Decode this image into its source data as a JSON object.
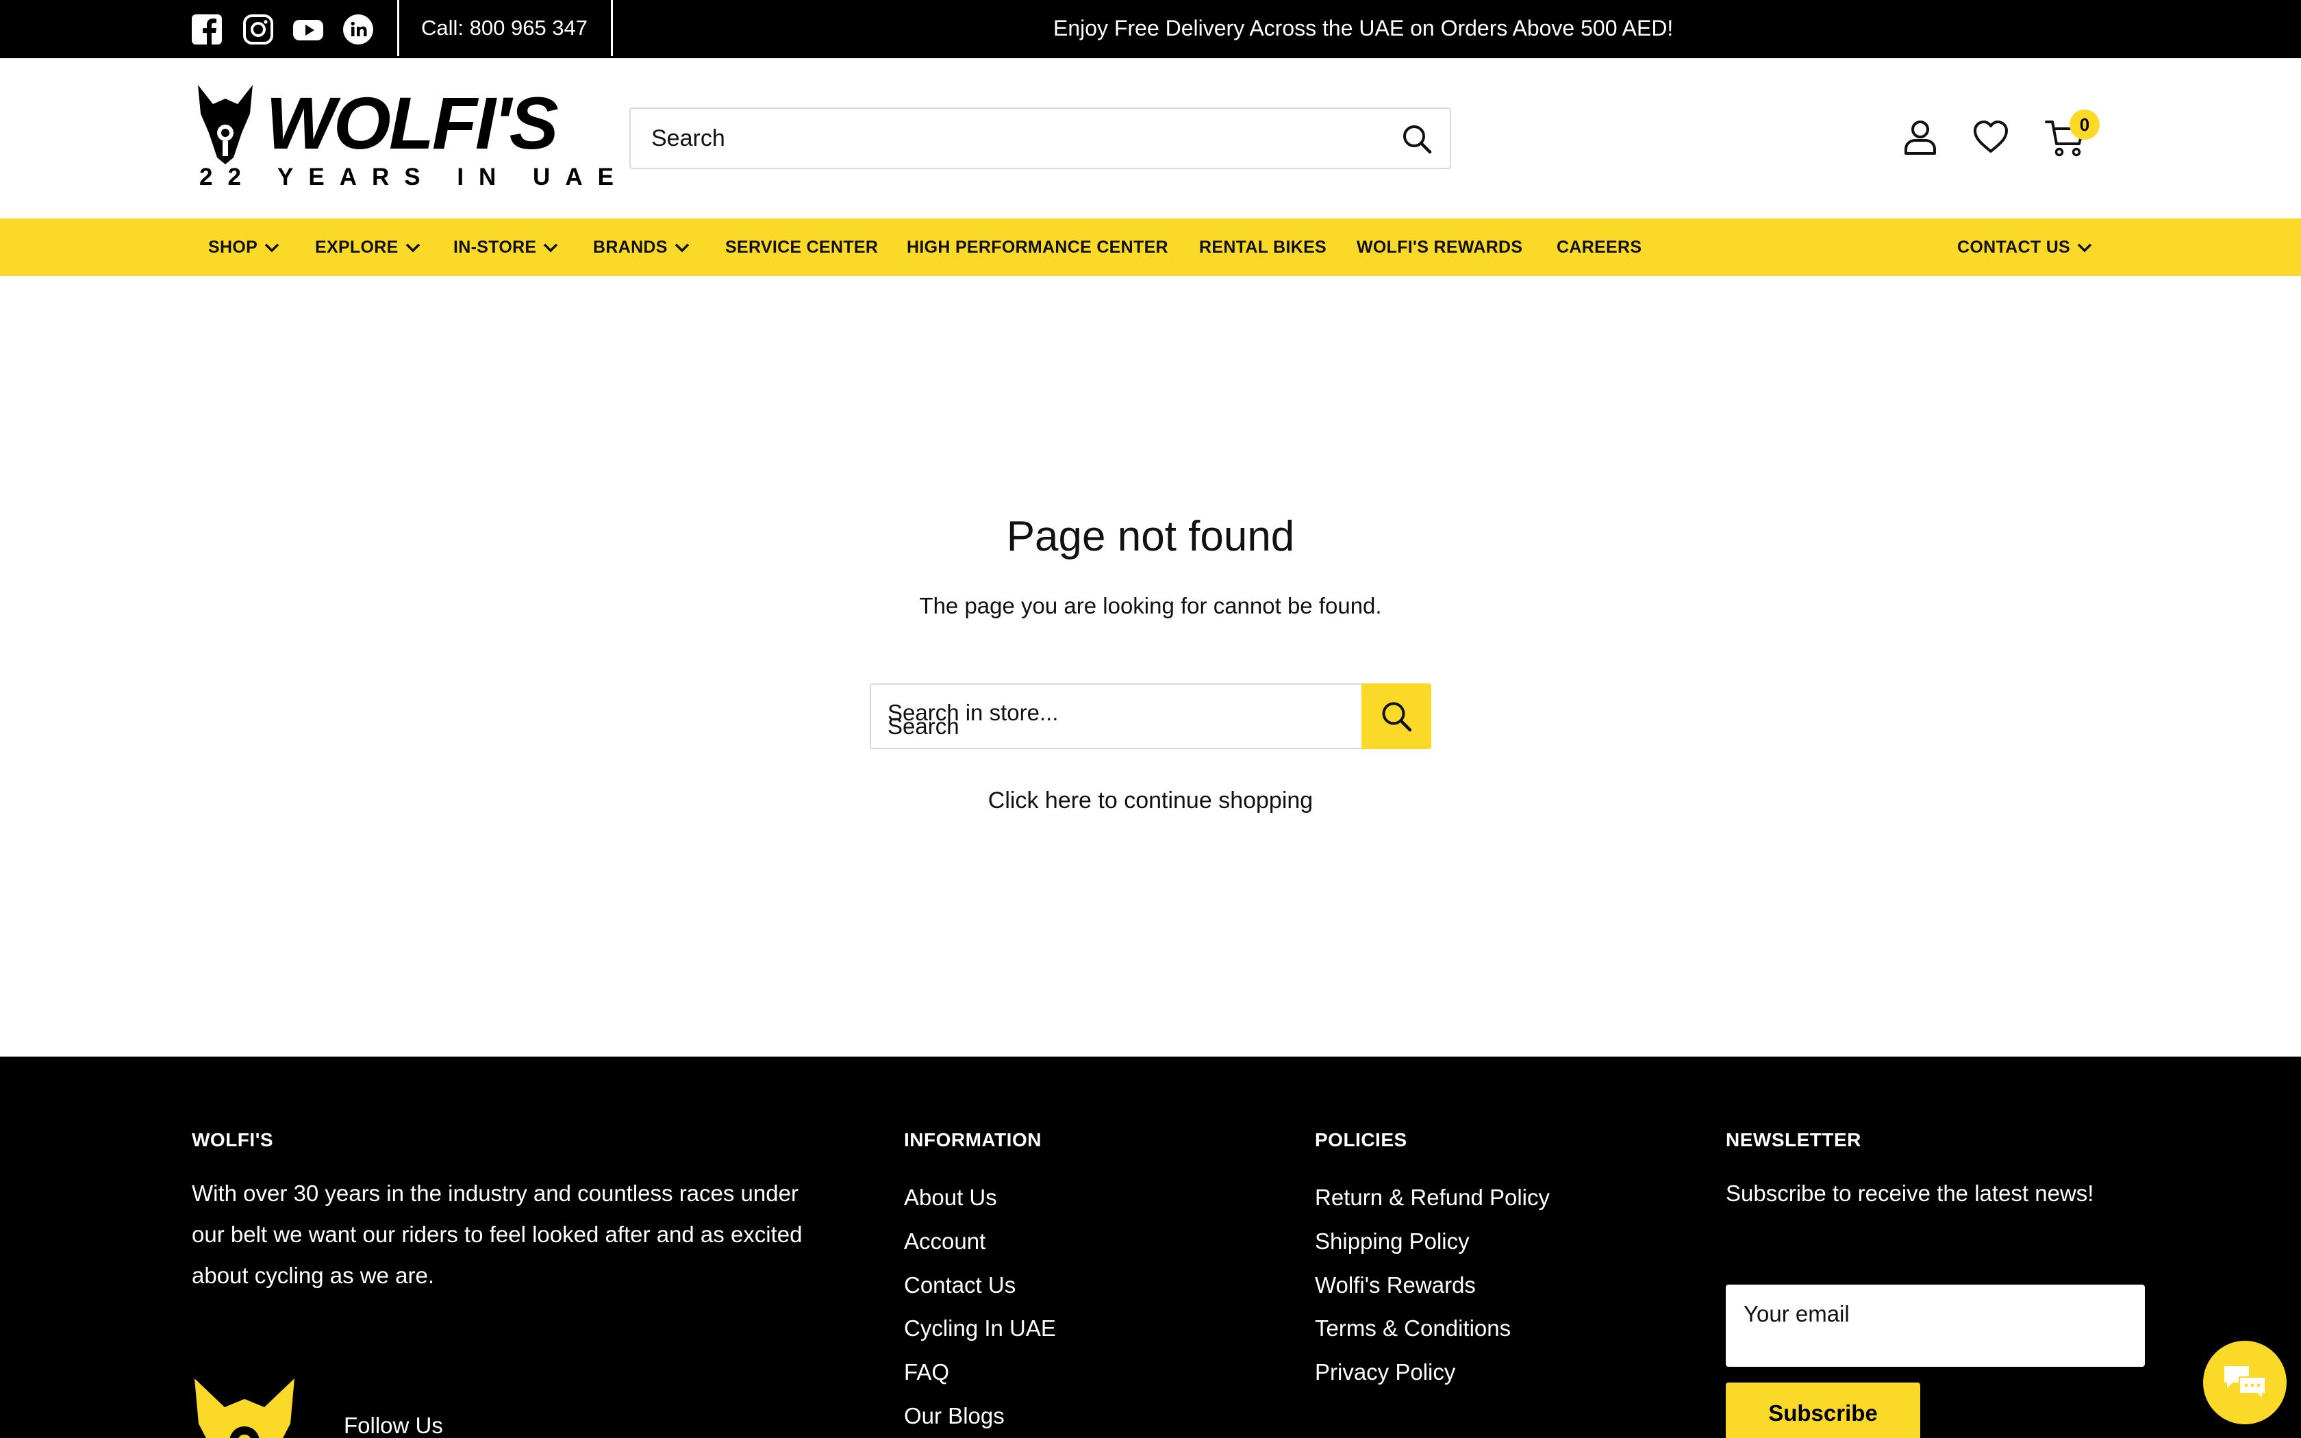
{
  "topbar": {
    "social": [
      {
        "name": "facebook-icon"
      },
      {
        "name": "instagram-icon"
      },
      {
        "name": "youtube-icon"
      },
      {
        "name": "linkedin-icon"
      }
    ],
    "call": "Call: 800 965 347",
    "announcement": "Enjoy Free Delivery Across the UAE on Orders Above 500 AED!"
  },
  "header": {
    "logo_word": "WOLFI'S",
    "logo_tag": "22 YEARS IN UAE",
    "search_placeholder": "Search",
    "cart_count": "0"
  },
  "nav": {
    "items": [
      {
        "label": "SHOP",
        "dropdown": true
      },
      {
        "label": "EXPLORE",
        "dropdown": true
      },
      {
        "label": "IN-STORE",
        "dropdown": true
      },
      {
        "label": "BRANDS",
        "dropdown": true
      },
      {
        "label": "SERVICE CENTER",
        "dropdown": false
      },
      {
        "label": "HIGH PERFORMANCE CENTER",
        "dropdown": false
      },
      {
        "label": "RENTAL BIKES",
        "dropdown": false
      },
      {
        "label": "WOLFI'S REWARDS",
        "dropdown": false
      },
      {
        "label": "CAREERS",
        "dropdown": false
      }
    ],
    "contact": {
      "label": "CONTACT US",
      "dropdown": true
    }
  },
  "main": {
    "title": "Page not found",
    "subtitle": "The page you are looking for cannot be found.",
    "store_search_placeholder": "Search in store...",
    "store_search_overlap_label": "Search",
    "continue_link": "Click here to continue shopping"
  },
  "footer": {
    "about": {
      "heading": "WOLFI'S",
      "text": "With over 30 years in the industry and countless races under our belt we want our riders to feel looked after and as excited about cycling as we are.",
      "follow": "Follow Us"
    },
    "information": {
      "heading": "INFORMATION",
      "links": [
        "About Us",
        "Account",
        "Contact Us",
        "Cycling In UAE",
        "FAQ",
        "Our Blogs"
      ]
    },
    "policies": {
      "heading": "POLICIES",
      "links": [
        "Return & Refund Policy",
        "Shipping Policy",
        "Wolfi's Rewards",
        "Terms & Conditions",
        "Privacy Policy"
      ]
    },
    "newsletter": {
      "heading": "NEWSLETTER",
      "text": "Subscribe to receive the latest news!",
      "email_placeholder": "Your email",
      "button": "Subscribe"
    }
  },
  "colors": {
    "brand_yellow": "#fbd928",
    "black": "#000000",
    "white": "#ffffff"
  },
  "chat": {
    "icon": "chat-icon"
  }
}
